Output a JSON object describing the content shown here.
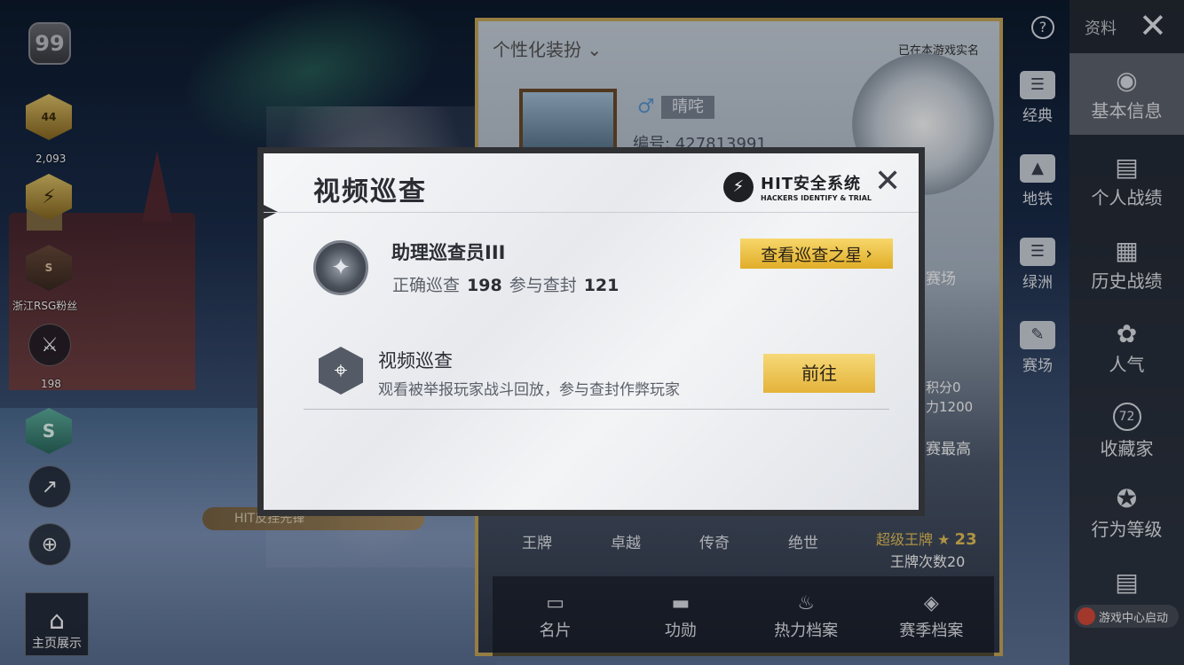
{
  "left_sidebar": {
    "level": "99",
    "rank_badge_number": "44",
    "score": "2,093",
    "team_label": "浙江RSG粉丝",
    "weapon_count": "198",
    "home_label": "主页展示",
    "hit_tag_text": "HIT反挂先锋"
  },
  "profile_panel": {
    "header": "个性化装扮",
    "realname_notice": "已在本游戏实名",
    "player_name": "晴咤",
    "player_id": "编号: 427813991",
    "side_labels": [
      "赛场",
      "积分0",
      "力1200",
      "赛最高"
    ],
    "rank_tiers": [
      "王牌",
      "卓越",
      "传奇",
      "绝世"
    ],
    "super_king_label": "超级王牌",
    "super_king_count": "23",
    "king_times": "王牌次数20",
    "bottom_tabs": [
      {
        "label": "名片",
        "icon": "card-icon"
      },
      {
        "label": "功勋",
        "icon": "medal-icon"
      },
      {
        "label": "热力档案",
        "icon": "fire-icon"
      },
      {
        "label": "赛季档案",
        "icon": "season-icon"
      }
    ]
  },
  "mid_column": [
    {
      "label": "经典",
      "icon": "classic-icon"
    },
    {
      "label": "地铁",
      "icon": "metro-icon"
    },
    {
      "label": "绿洲",
      "icon": "oasis-icon"
    },
    {
      "label": "赛场",
      "icon": "arena-icon"
    }
  ],
  "right_column": {
    "resource_label": "资料",
    "items": [
      {
        "label": "基本信息",
        "icon": "person-icon",
        "active": true
      },
      {
        "label": "个人战绩",
        "icon": "stats-icon"
      },
      {
        "label": "历史战绩",
        "icon": "history-icon"
      },
      {
        "label": "人气",
        "icon": "popularity-icon"
      },
      {
        "label": "收藏家",
        "icon": "collector-icon",
        "badge": "72"
      },
      {
        "label": "行为等级",
        "icon": "behavior-icon"
      }
    ],
    "game_center": "游戏中心启动"
  },
  "modal": {
    "title": "视频巡查",
    "logo_text": "HIT安全系统",
    "logo_sub": "HACKERS IDENTIFY & TRIAL",
    "rank_name": "助理巡查员III",
    "correct_label": "正确巡查",
    "correct_count": "198",
    "ban_label": "参与查封",
    "ban_count": "121",
    "star_button": "查看巡查之星",
    "task_title": "视频巡查",
    "task_desc": "观看被举报玩家战斗回放，参与查封作弊玩家",
    "goto_button": "前往"
  }
}
